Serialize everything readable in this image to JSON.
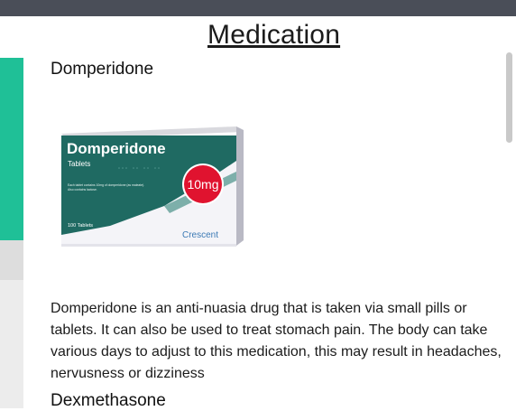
{
  "page": {
    "title": "Medication"
  },
  "medications": [
    {
      "name": "Domperidone",
      "image": {
        "brand": "Domperidone",
        "form": "Tablets",
        "dose": "10mg",
        "fine_print_1": "Each tablet contains 10mg of domperidone (as maleate).",
        "fine_print_2": "Also contains lactose.",
        "count": "100 Tablets",
        "maker": "Crescent"
      },
      "description": "Domperidone is an anti-nuasia drug that is taken via small pills or tablets. It can also be used to treat stomach pain. The body can take various days to adjust to this medication, this may result in headaches, nervusness or dizziness"
    },
    {
      "name": "Dexmethasone"
    }
  ],
  "colors": {
    "accent": "#1fc097",
    "topbar": "#4a4e58",
    "box_teal": "#1f6a62",
    "dose_badge": "#e0132f"
  }
}
